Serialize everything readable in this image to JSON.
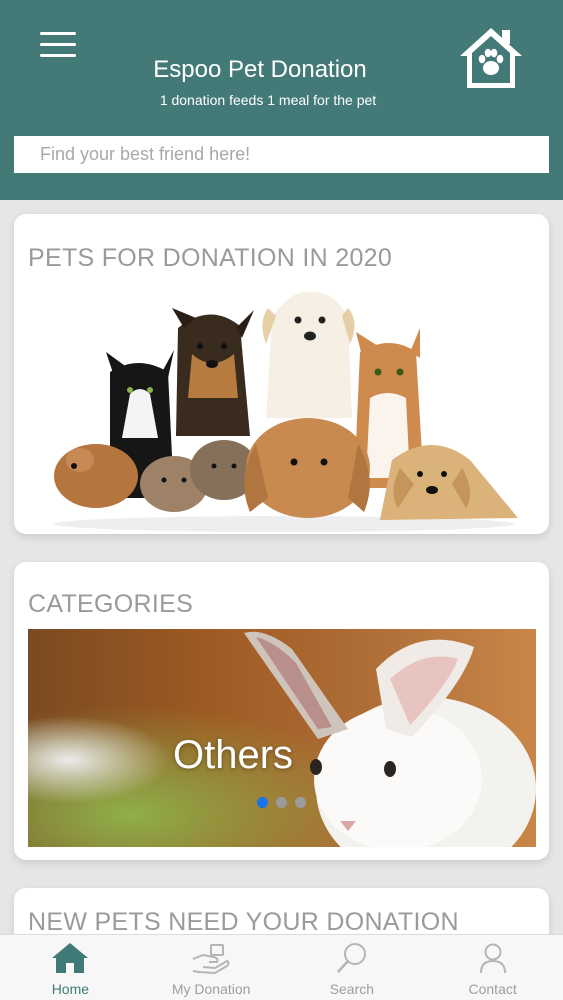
{
  "header": {
    "title": "Espoo Pet Donation",
    "subtitle": "1 donation feeds 1 meal for the pet",
    "menu_icon": "hamburger-menu-icon",
    "logo_icon": "house-paw-icon",
    "background": "#437a78"
  },
  "search": {
    "placeholder": "Find your best friend here!",
    "value": ""
  },
  "featured": {
    "title": "PETS FOR DONATION IN 2020"
  },
  "categories": {
    "title": "CATEGORIES",
    "current_slide": "Others",
    "slide_count": 3,
    "active_index": 0
  },
  "new_pets": {
    "title": "NEW PETS NEED YOUR DONATION"
  },
  "tabbar": {
    "tabs": [
      {
        "label": "Home",
        "icon": "home-icon",
        "active": true
      },
      {
        "label": "My Donation",
        "icon": "donation-hand-icon",
        "active": false
      },
      {
        "label": "Search",
        "icon": "search-icon",
        "active": false
      },
      {
        "label": "Contact",
        "icon": "user-icon",
        "active": false
      }
    ],
    "active_color": "#3f7a77",
    "inactive_color": "#9e9e9e"
  }
}
